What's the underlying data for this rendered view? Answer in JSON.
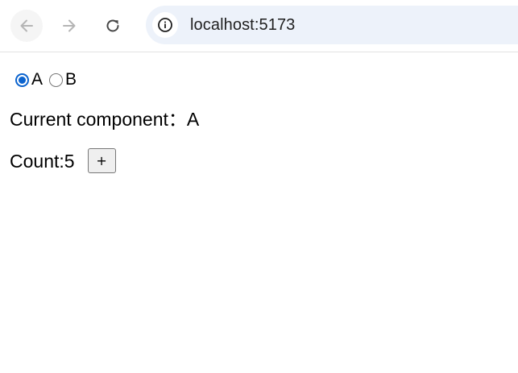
{
  "browser": {
    "url": "localhost:5173",
    "icons": {
      "back": "arrow-left-icon",
      "forward": "arrow-right-icon",
      "reload": "reload-icon",
      "site_info": "info-icon"
    }
  },
  "page": {
    "radios": [
      {
        "label": "A",
        "checked": true
      },
      {
        "label": "B",
        "checked": false
      }
    ],
    "current_component_label": "Current component：",
    "current_component_value": "A",
    "count_label": "Count: ",
    "count_value": "5",
    "increment_label": "+",
    "accent_color": "#0b63ce"
  }
}
